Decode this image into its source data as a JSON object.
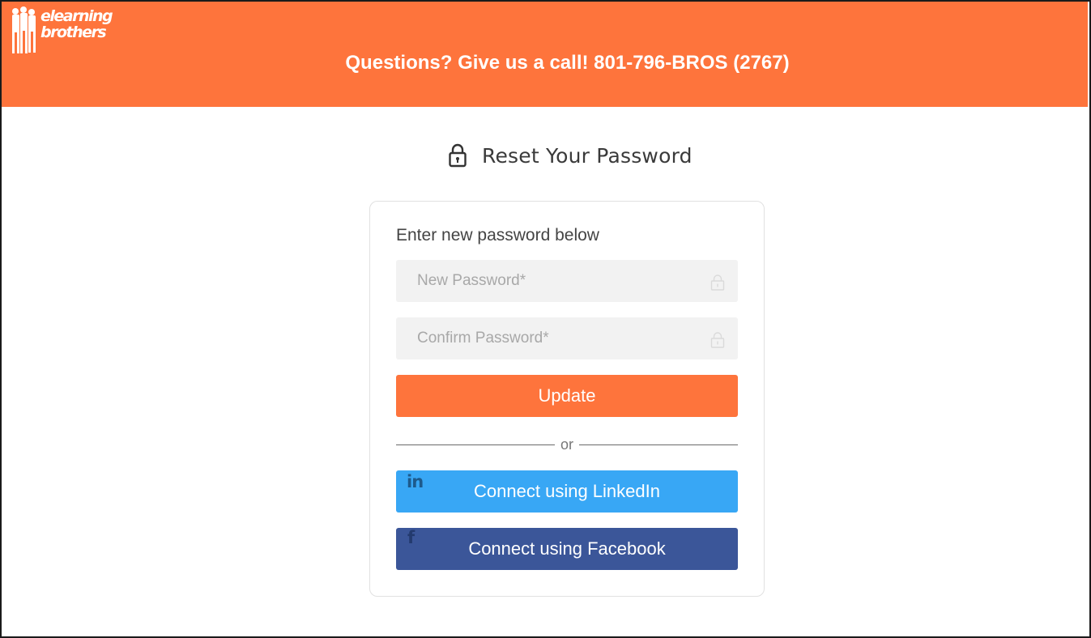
{
  "header": {
    "logo_line1": "elearning",
    "logo_line2": "brothers",
    "call_text": "Questions? Give us a call! 801-796-BROS (2767)",
    "background_color": "#fe743c"
  },
  "page": {
    "title": "Reset Your Password",
    "title_icon": "lock-icon"
  },
  "form": {
    "instruction": "Enter new password below",
    "new_password": {
      "placeholder": "New Password*",
      "value": "",
      "icon": "lock-icon"
    },
    "confirm_password": {
      "placeholder": "Confirm Password*",
      "value": "",
      "icon": "lock-icon"
    },
    "update_label": "Update",
    "divider_label": "or",
    "linkedin": {
      "label": "Connect using LinkedIn",
      "icon_glyph": "in",
      "icon": "linkedin-icon",
      "color": "#38a7f5"
    },
    "facebook": {
      "label": "Connect using Facebook",
      "icon_glyph": "f",
      "icon": "facebook-icon",
      "color": "#3b5699"
    }
  },
  "colors": {
    "accent": "#fe743c",
    "linkedin": "#38a7f5",
    "facebook": "#3b5699"
  }
}
